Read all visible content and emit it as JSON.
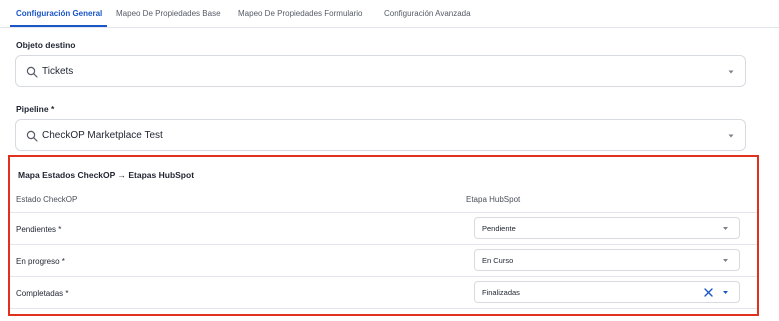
{
  "tabs": [
    {
      "label": "Configuración General",
      "active": true
    },
    {
      "label": "Mapeo De Propiedades Base",
      "active": false
    },
    {
      "label": "Mapeo De Propiedades Formulario",
      "active": false
    },
    {
      "label": "Configuración Avanzada",
      "active": false
    }
  ],
  "objeto_destino": {
    "label": "Objeto destino",
    "value": "Tickets"
  },
  "pipeline": {
    "label": "Pipeline *",
    "value": "CheckOP Marketplace Test"
  },
  "mapping": {
    "title": "Mapa Estados CheckOP → Etapas HubSpot",
    "col_estado": "Estado CheckOP",
    "col_etapa": "Etapa HubSpot",
    "rows": [
      {
        "estado": "Pendientes *",
        "etapa": "Pendiente",
        "clearable": false
      },
      {
        "estado": "En progreso *",
        "etapa": "En Curso",
        "clearable": false
      },
      {
        "estado": "Completadas *",
        "etapa": "Finalizadas",
        "clearable": true
      }
    ]
  },
  "colors": {
    "accent": "#1a56c7",
    "highlight_border": "#e0301e",
    "border": "#d7dbe0"
  },
  "icons": {
    "search": "search-icon",
    "caret": "chevron-down-icon",
    "clear": "close-icon"
  }
}
